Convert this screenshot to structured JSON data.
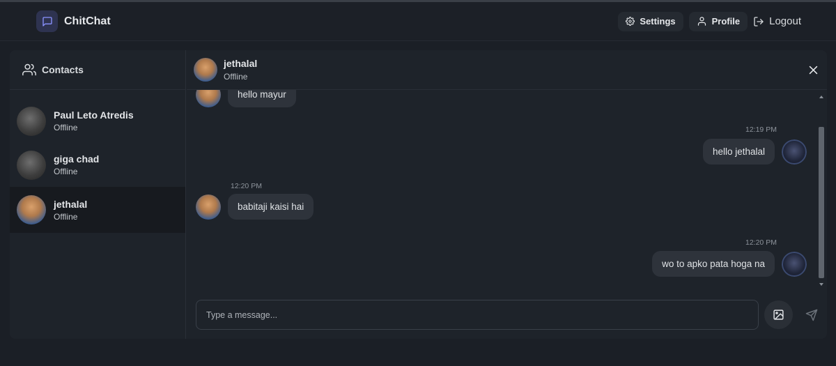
{
  "app": {
    "name": "ChitChat",
    "logo_icon": "message-square-icon",
    "accent": "#2e3350"
  },
  "nav": {
    "settings_label": "Settings",
    "profile_label": "Profile",
    "logout_label": "Logout"
  },
  "sidebar": {
    "title": "Contacts",
    "contacts": [
      {
        "name": "Paul Leto Atredis",
        "status": "Offline"
      },
      {
        "name": "giga chad",
        "status": "Offline"
      },
      {
        "name": "jethalal",
        "status": "Offline",
        "active": true
      }
    ]
  },
  "chat": {
    "contact_name": "jethalal",
    "contact_status": "Offline",
    "messages": [
      {
        "side": "left",
        "text": "hello mayur",
        "time": ""
      },
      {
        "side": "right",
        "text": "hello jethalal",
        "time": "12:19 PM"
      },
      {
        "side": "left",
        "text": "babitaji kaisi hai",
        "time": "12:20 PM"
      },
      {
        "side": "right",
        "text": "wo to apko pata hoga na",
        "time": "12:20 PM"
      }
    ],
    "input_placeholder": "Type a message...",
    "input_value": ""
  }
}
